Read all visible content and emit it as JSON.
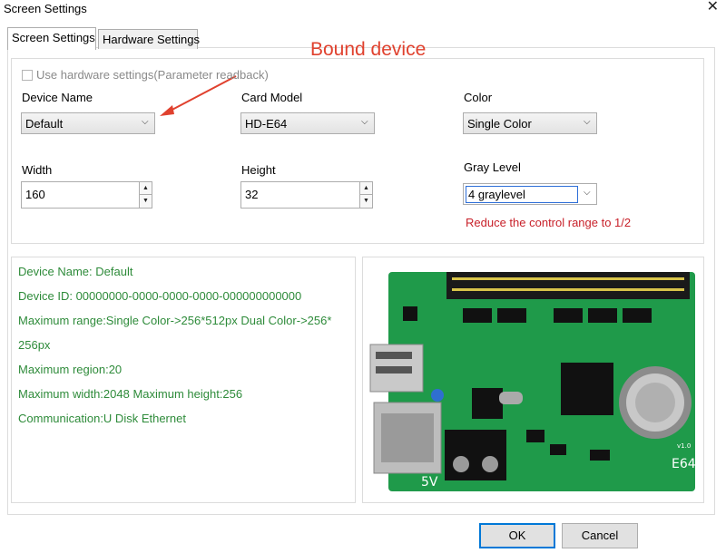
{
  "window": {
    "title": "Screen Settings",
    "close_glyph": "✕"
  },
  "tabs": [
    {
      "label": "Screen Settings",
      "active": true
    },
    {
      "label": "Hardware Settings",
      "active": false
    }
  ],
  "annotation": {
    "text": "Bound device",
    "color": "#e0412e"
  },
  "hardware_checkbox": {
    "label": "Use hardware settings(Parameter readback)",
    "checked": false
  },
  "fields": {
    "device_name": {
      "label": "Device Name",
      "value": "Default"
    },
    "card_model": {
      "label": "Card Model",
      "value": "HD-E64"
    },
    "color": {
      "label": "Color",
      "value": "Single Color"
    },
    "width": {
      "label": "Width",
      "value": "160"
    },
    "height": {
      "label": "Height",
      "value": "32"
    },
    "gray_level": {
      "label": "Gray Level",
      "value": "4 graylevel"
    }
  },
  "warning": {
    "text": "Reduce the control range to 1/2",
    "color": "#c8212a"
  },
  "info": {
    "color": "#2e8b3a",
    "lines": [
      "Device Name: Default",
      "Device ID:  00000000-0000-0000-0000-000000000000",
      "Maximum range:Single Color->256*512px  Dual Color->256*",
      "256px",
      "Maximum region:20",
      "Maximum width:2048 Maximum height:256",
      "Communication:U Disk  Ethernet"
    ]
  },
  "board": {
    "model_text": "E64",
    "version_text": "v1.0",
    "voltage_text": "5V"
  },
  "buttons": {
    "ok": "OK",
    "cancel": "Cancel"
  }
}
